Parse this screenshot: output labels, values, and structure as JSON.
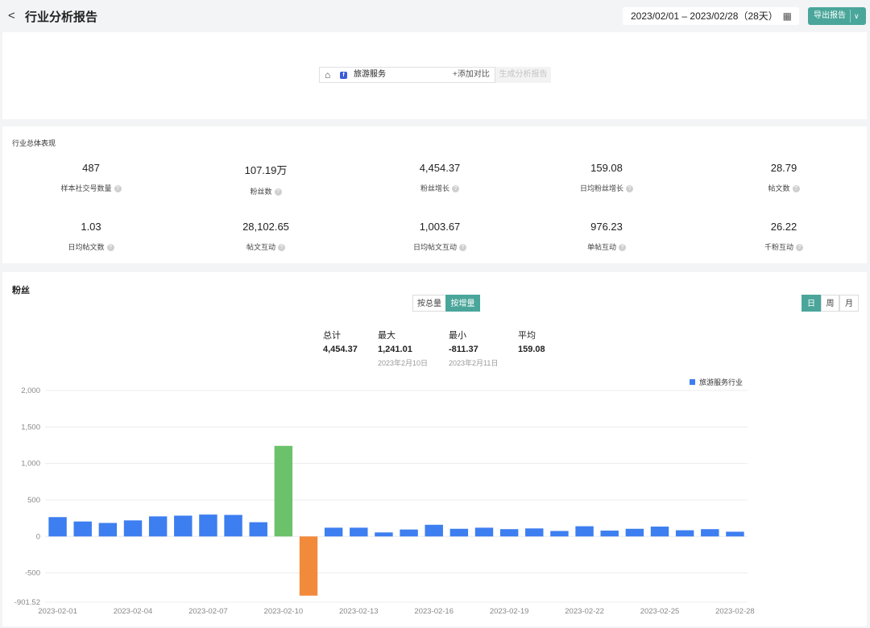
{
  "header": {
    "back_icon": "chevron-left-icon",
    "title": "行业分析报告",
    "date_range": "2023/02/01 – 2023/02/28（28天）",
    "calendar_icon": "calendar-icon",
    "export_label": "导出报告"
  },
  "search": {
    "home_icon": "home-icon",
    "platform_icon": "facebook-icon",
    "industry": "旅游服务",
    "add_compare": "+添加对比",
    "generate": "生成分析报告"
  },
  "overview": {
    "title": "行业总体表现",
    "metrics": [
      {
        "value": "487",
        "label": "样本社交号数量"
      },
      {
        "value": "107.19万",
        "label": "粉丝数"
      },
      {
        "value": "4,454.37",
        "label": "粉丝增长"
      },
      {
        "value": "159.08",
        "label": "日均粉丝增长"
      },
      {
        "value": "28.79",
        "label": "帖文数"
      },
      {
        "value": "1.03",
        "label": "日均帖文数"
      },
      {
        "value": "28,102.65",
        "label": "帖文互动"
      },
      {
        "value": "1,003.67",
        "label": "日均帖文互动"
      },
      {
        "value": "976.23",
        "label": "单帖互动"
      },
      {
        "value": "26.22",
        "label": "千粉互动"
      }
    ]
  },
  "fans": {
    "title": "粉丝",
    "mode_total": "按总量",
    "mode_increment": "按增量",
    "period_day": "日",
    "period_week": "周",
    "period_month": "月",
    "stats": {
      "total_label": "总计",
      "total_value": "4,454.37",
      "max_label": "最大",
      "max_value": "1,241.01",
      "max_date": "2023年2月10日",
      "min_label": "最小",
      "min_value": "-811.37",
      "min_date": "2023年2月11日",
      "avg_label": "平均",
      "avg_value": "159.08"
    }
  },
  "chart_data": {
    "type": "bar",
    "title": "",
    "xlabel": "",
    "ylabel": "",
    "legend": [
      "旅游服务行业"
    ],
    "legend_position": "top-right",
    "ylim": [
      -901.52,
      2000
    ],
    "yticks": [
      2000,
      1500,
      1000,
      500,
      0,
      -500,
      -901.52
    ],
    "ytick_labels": [
      "2,000",
      "1,500",
      "1,000",
      "500",
      "0",
      "-500",
      "-901.52"
    ],
    "x": [
      "2023-02-01",
      "2023-02-02",
      "2023-02-03",
      "2023-02-04",
      "2023-02-05",
      "2023-02-06",
      "2023-02-07",
      "2023-02-08",
      "2023-02-09",
      "2023-02-10",
      "2023-02-11",
      "2023-02-12",
      "2023-02-13",
      "2023-02-14",
      "2023-02-15",
      "2023-02-16",
      "2023-02-17",
      "2023-02-18",
      "2023-02-19",
      "2023-02-20",
      "2023-02-21",
      "2023-02-22",
      "2023-02-23",
      "2023-02-24",
      "2023-02-25",
      "2023-02-26",
      "2023-02-27",
      "2023-02-28"
    ],
    "x_tick_labels": [
      "2023-02-01",
      "2023-02-04",
      "2023-02-07",
      "2023-02-10",
      "2023-02-13",
      "2023-02-16",
      "2023-02-19",
      "2023-02-22",
      "2023-02-25",
      "2023-02-28"
    ],
    "series": [
      {
        "name": "旅游服务行业",
        "values": [
          265,
          205,
          185,
          220,
          275,
          285,
          300,
          295,
          195,
          1241.01,
          -811.37,
          120,
          120,
          55,
          95,
          160,
          105,
          120,
          100,
          110,
          75,
          140,
          80,
          105,
          135,
          85,
          100,
          65
        ]
      }
    ],
    "colors": {
      "default": "#3d7ef0",
      "max": "#6bc26b",
      "min": "#f28a3c"
    },
    "grid": true
  }
}
